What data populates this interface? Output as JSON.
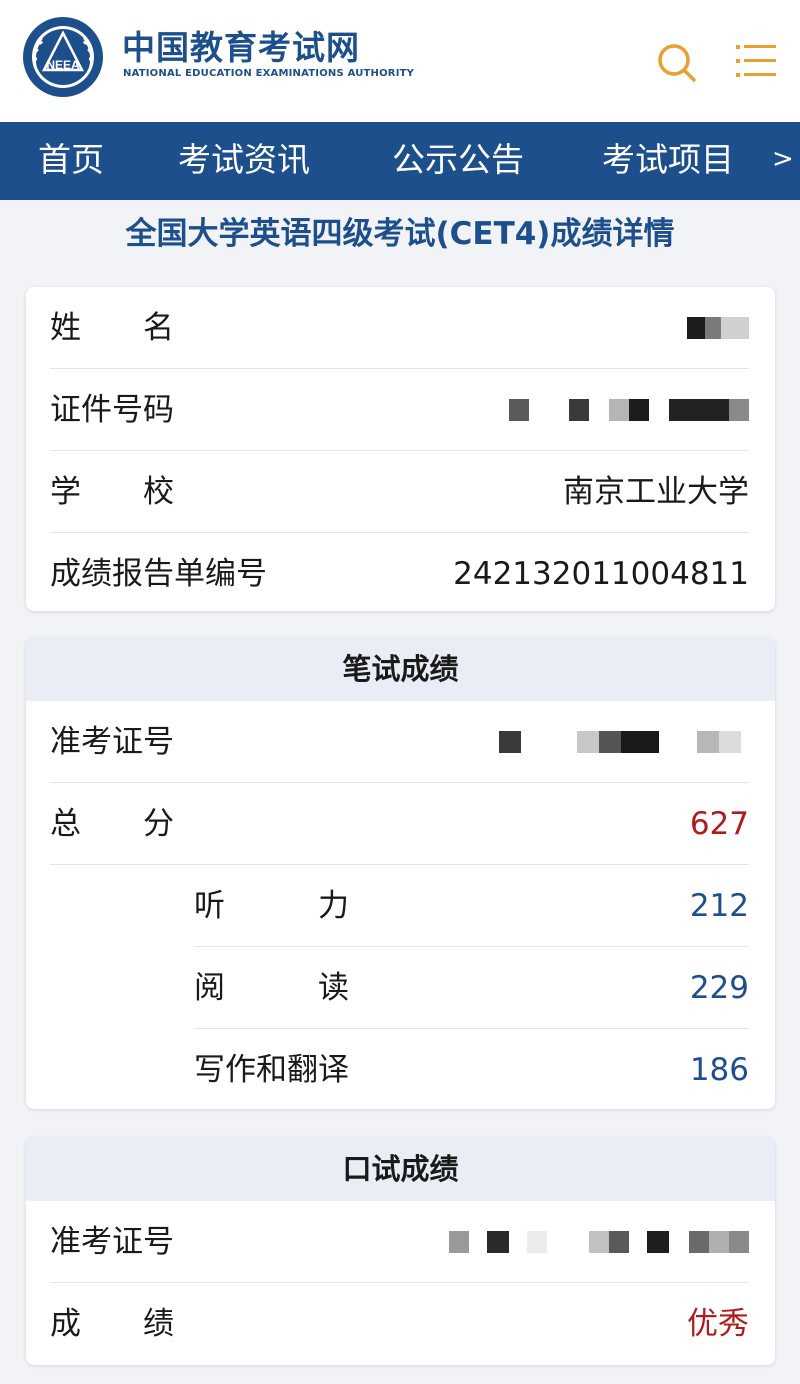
{
  "header": {
    "site_title": "中国教育考试网",
    "site_subtitle": "NATIONAL EDUCATION EXAMINATIONS AUTHORITY",
    "logo_text": "NEEA",
    "search_icon": "search-icon",
    "menu_icon": "menu-icon"
  },
  "nav": {
    "items": [
      "首页",
      "考试资讯",
      "公示公告",
      "考试项目"
    ],
    "more": ">"
  },
  "page": {
    "title": "全国大学英语四级考试(CET4)成绩详情"
  },
  "info": {
    "name_label": "姓　　名",
    "id_label": "证件号码",
    "school_label": "学　　校",
    "school_value": "南京工业大学",
    "report_label": "成绩报告单编号",
    "report_value": "242132011004811"
  },
  "written": {
    "header": "笔试成绩",
    "ticket_label": "准考证号",
    "total_label": "总　　分",
    "total_value": "627",
    "listening_label": "听　　　力",
    "listening_value": "212",
    "reading_label": "阅　　　读",
    "reading_value": "229",
    "writing_label": "写作和翻译",
    "writing_value": "186"
  },
  "oral": {
    "header": "口试成绩",
    "ticket_label": "准考证号",
    "grade_label": "成　　绩",
    "grade_value": "优秀"
  },
  "colors": {
    "brand_blue": "#1d4f8c",
    "accent_orange": "#e8a030",
    "score_red": "#b01c1c"
  }
}
